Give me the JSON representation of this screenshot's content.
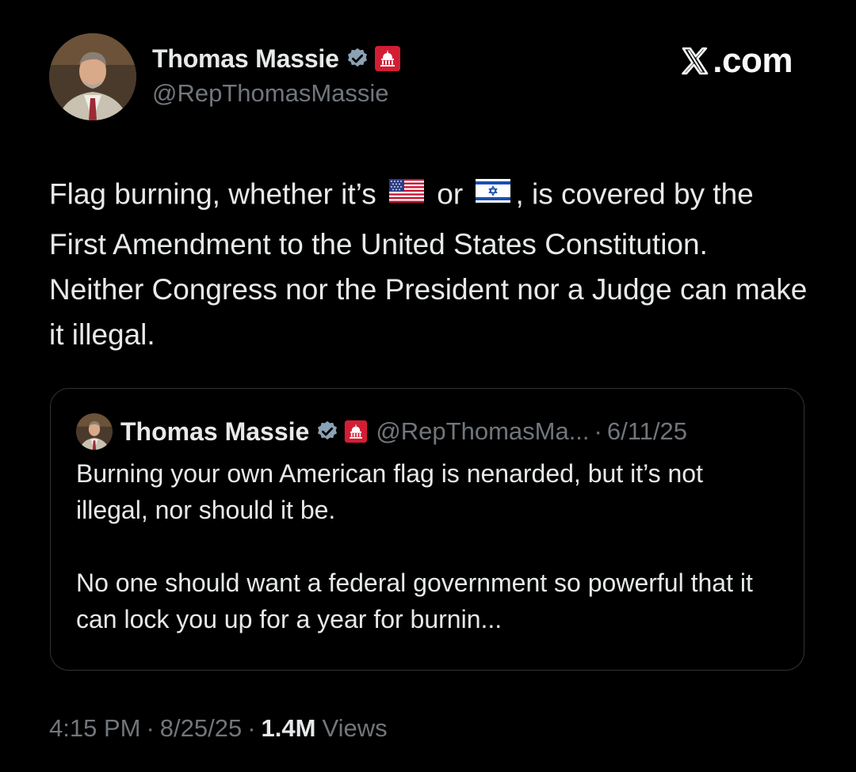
{
  "brand": {
    "label": ".com",
    "icon": "x-logo-icon"
  },
  "author": {
    "name": "Thomas Massie",
    "handle": "@RepThomasMassie",
    "verified_icon": "verified-check-icon",
    "affiliation_icon": "gop-capitol-badge-icon"
  },
  "tweet": {
    "text_part1": "Flag burning, whether it’s",
    "flag1_icon": "us-flag-icon",
    "text_part2": "or",
    "flag2_icon": "israel-flag-icon",
    "text_part3": ", is covered by the First Amendment to the United States Constitution. Neither Congress nor the President nor a Judge can make it illegal."
  },
  "quote": {
    "name": "Thomas Massie",
    "handle": "@RepThomasMa...",
    "dot": "·",
    "date": "6/11/25",
    "paragraph1": "Burning your own American flag is nenarded, but it’s not illegal, nor should it be.",
    "paragraph2": "No one should want a federal government so powerful that it can lock you up for a year for burnin..."
  },
  "meta": {
    "time": "4:15 PM",
    "sep": "·",
    "date": "8/25/25",
    "views_count": "1.4M",
    "views_label": "Views"
  },
  "colors": {
    "background": "#000000",
    "text": "#e7e9ea",
    "secondary": "#71767b",
    "verified": "#8ba2b4",
    "gop_red": "#d21e34",
    "border": "#2f3336"
  }
}
